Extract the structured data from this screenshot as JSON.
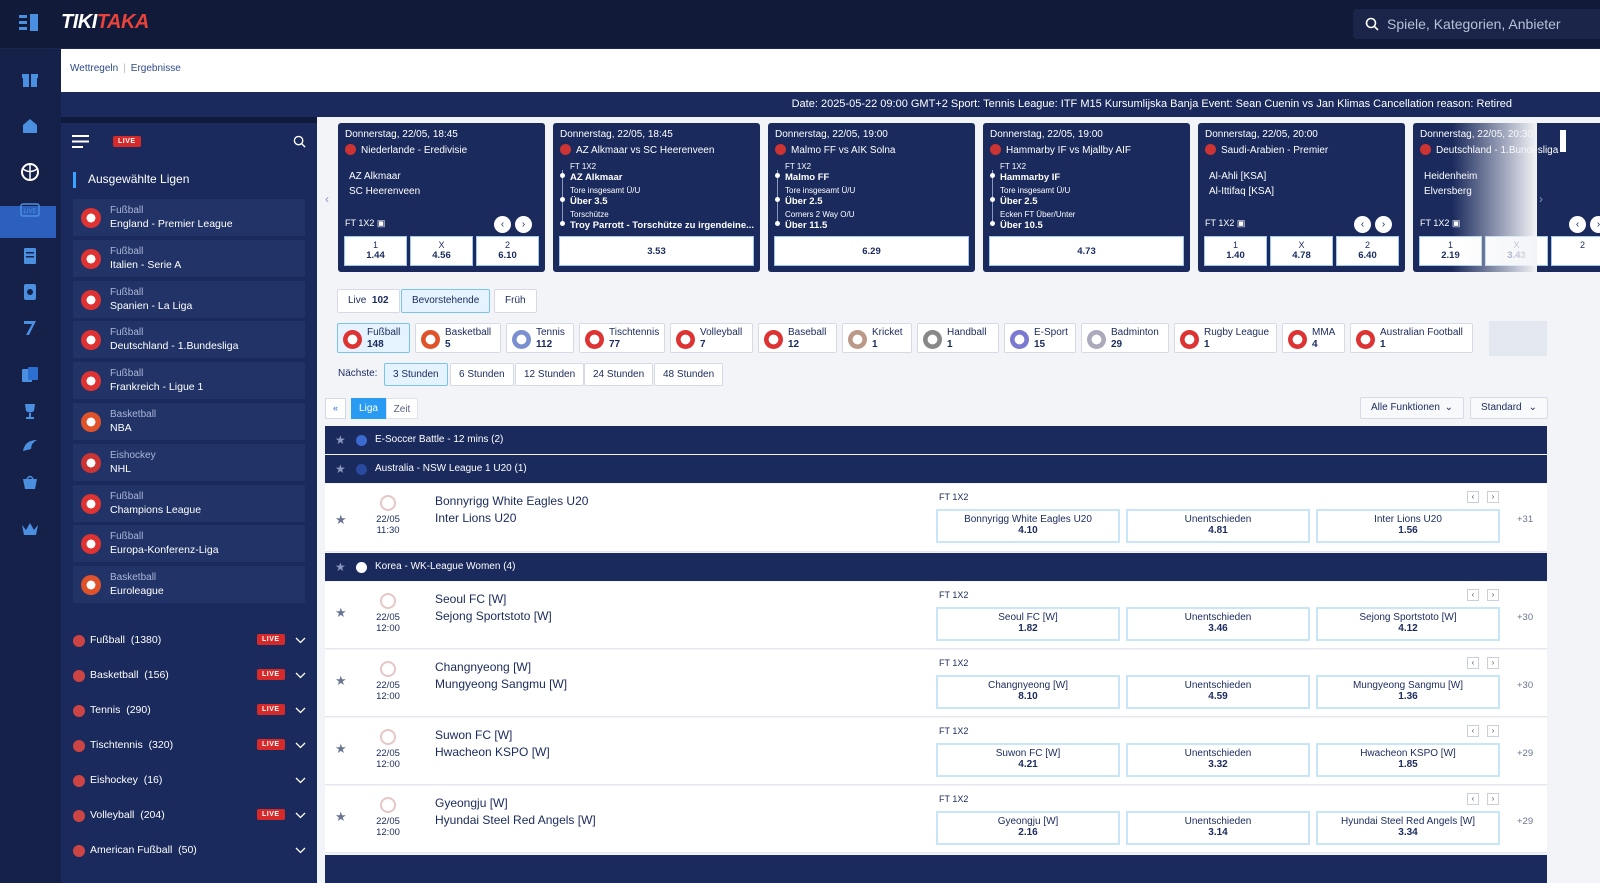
{
  "app": {
    "logo_a": "TIKI",
    "logo_b": "TAKA",
    "search_placeholder": "Spiele, Kategorien, Anbieter"
  },
  "breadcrumb": {
    "a": "Wettregeln",
    "b": "Ergebnisse"
  },
  "ticker": "Date: 2025-05-22 09:00 GMT+2 Sport: Tennis League: ITF M15 Kursumlijska Banja Event: Sean Cuenin vs Jan Klimas Cancellation reason: Retired",
  "sidebar": {
    "live": "LIVE",
    "title": "Ausgewählte Ligen",
    "leagues": [
      {
        "sport": "Fußball",
        "name": "England - Premier League"
      },
      {
        "sport": "Fußball",
        "name": "Italien - Serie A"
      },
      {
        "sport": "Fußball",
        "name": "Spanien - La Liga"
      },
      {
        "sport": "Fußball",
        "name": "Deutschland - 1.Bundesliga"
      },
      {
        "sport": "Fußball",
        "name": "Frankreich - Ligue 1"
      },
      {
        "sport": "Basketball",
        "name": "NBA"
      },
      {
        "sport": "Eishockey",
        "name": "NHL"
      },
      {
        "sport": "Fußball",
        "name": "Champions League"
      },
      {
        "sport": "Fußball",
        "name": "Europa-Konferenz-Liga"
      },
      {
        "sport": "Basketball",
        "name": "Euroleague"
      }
    ],
    "sports": [
      {
        "name": "Fußball",
        "count": "(1380)",
        "live": "LIVE"
      },
      {
        "name": "Basketball",
        "count": "(156)",
        "live": "LIVE"
      },
      {
        "name": "Tennis",
        "count": "(290)",
        "live": "LIVE"
      },
      {
        "name": "Tischtennis",
        "count": "(320)",
        "live": "LIVE"
      },
      {
        "name": "Eishockey",
        "count": "(16)",
        "live": ""
      },
      {
        "name": "Volleyball",
        "count": "(204)",
        "live": "LIVE"
      },
      {
        "name": "American Fußball",
        "count": "(50)",
        "live": ""
      }
    ]
  },
  "cards": [
    {
      "date": "Donnerstag, 22/05, 18:45",
      "league": "Niederlande - Eredivisie",
      "t1": "AZ Alkmaar",
      "t2": "SC Heerenveen",
      "market": "FT 1X2",
      "odds": [
        {
          "l": "1",
          "v": "1.44"
        },
        {
          "l": "X",
          "v": "4.56"
        },
        {
          "l": "2",
          "v": "6.10"
        }
      ]
    },
    {
      "date": "Donnerstag, 22/05, 18:45",
      "league": "AZ Alkmaar vs SC Heerenveen",
      "b1": "FT 1X2",
      "b1v": "AZ Alkmaar",
      "b2": "Tore insgesamt Ü/U",
      "b2v": "Über 3.5",
      "b3": "Torschütze",
      "b3v": "Troy Parrott - Torschütze zu irgendeine...",
      "total": "3.53"
    },
    {
      "date": "Donnerstag, 22/05, 19:00",
      "league": "Malmo FF vs AIK Solna",
      "b1": "FT 1X2",
      "b1v": "Malmo FF",
      "b2": "Tore insgesamt Ü/U",
      "b2v": "Über 2.5",
      "b3": "Corners 2 Way O/U",
      "b3v": "Über 11.5",
      "total": "6.29"
    },
    {
      "date": "Donnerstag, 22/05, 19:00",
      "league": "Hammarby IF vs Mjallby AIF",
      "b1": "FT 1X2",
      "b1v": "Hammarby IF",
      "b2": "Tore insgesamt Ü/U",
      "b2v": "Über 2.5",
      "b3": "Ecken FT Über/Unter",
      "b3v": "Über 10.5",
      "total": "4.73"
    },
    {
      "date": "Donnerstag, 22/05, 20:00",
      "league": "Saudi-Arabien - Premier",
      "t1": "Al-Ahli [KSA]",
      "t2": "Al-Ittifaq [KSA]",
      "market": "FT 1X2",
      "odds": [
        {
          "l": "1",
          "v": "1.40"
        },
        {
          "l": "X",
          "v": "4.78"
        },
        {
          "l": "2",
          "v": "6.40"
        }
      ]
    },
    {
      "date": "Donnerstag, 22/05, 20:30",
      "league": "Deutschland - 1.Bundesliga",
      "t1": "Heidenheim",
      "t2": "Elversberg",
      "market": "FT 1X2",
      "odds": [
        {
          "l": "1",
          "v": "2.19"
        },
        {
          "l": "X",
          "v": "3.43"
        },
        {
          "l": "2",
          "v": ""
        }
      ]
    }
  ],
  "tabs": [
    {
      "label": "Live",
      "count": "102"
    },
    {
      "label": "Bevorstehende",
      "count": ""
    },
    {
      "label": "Früh",
      "count": ""
    }
  ],
  "sports_chips": [
    {
      "name": "Fußball",
      "count": "148",
      "color": "#d33"
    },
    {
      "name": "Basketball",
      "count": "5",
      "color": "#e0522a"
    },
    {
      "name": "Tennis",
      "count": "112",
      "color": "#7a8fd0"
    },
    {
      "name": "Tischtennis",
      "count": "77",
      "color": "#d33"
    },
    {
      "name": "Volleyball",
      "count": "7",
      "color": "#d33"
    },
    {
      "name": "Baseball",
      "count": "12",
      "color": "#d33"
    },
    {
      "name": "Kricket",
      "count": "1",
      "color": "#b98"
    },
    {
      "name": "Handball",
      "count": "1",
      "color": "#888"
    },
    {
      "name": "E-Sport",
      "count": "15",
      "color": "#7a7ad0"
    },
    {
      "name": "Badminton",
      "count": "29",
      "color": "#aab"
    },
    {
      "name": "Rugby League",
      "count": "1",
      "color": "#d33"
    },
    {
      "name": "MMA",
      "count": "4",
      "color": "#d33"
    },
    {
      "name": "Australian Football",
      "count": "1",
      "color": "#d33"
    }
  ],
  "hours": {
    "label": "Nächste:",
    "options": [
      "3 Stunden",
      "6 Stunden",
      "12 Stunden",
      "24 Stunden",
      "48 Stunden"
    ]
  },
  "view": {
    "liga": "Liga",
    "zeit": "Zeit",
    "funcs": "Alle Funktionen",
    "sort": "Standard"
  },
  "sections": [
    {
      "name": "E-Soccer Battle - 12 mins (2)"
    },
    {
      "name": "Australia - NSW League 1 U20 (1)"
    },
    {
      "name": "Korea - WK-League Women (4)"
    }
  ],
  "events": [
    {
      "date": "22/05",
      "time": "11:30",
      "home": "Bonnyrigg White Eagles U20",
      "away": "Inter Lions U20",
      "market": "FT 1X2",
      "o1": "4.10",
      "ox": "4.81",
      "o2": "1.56",
      "draw": "Unentschieden",
      "more": "+31"
    },
    {
      "date": "22/05",
      "time": "12:00",
      "home": "Seoul FC [W]",
      "away": "Sejong Sportstoto [W]",
      "market": "FT 1X2",
      "o1": "1.82",
      "ox": "3.46",
      "o2": "4.12",
      "draw": "Unentschieden",
      "more": "+30"
    },
    {
      "date": "22/05",
      "time": "12:00",
      "home": "Changnyeong [W]",
      "away": "Mungyeong Sangmu [W]",
      "market": "FT 1X2",
      "o1": "8.10",
      "ox": "4.59",
      "o2": "1.36",
      "draw": "Unentschieden",
      "more": "+30"
    },
    {
      "date": "22/05",
      "time": "12:00",
      "home": "Suwon FC [W]",
      "away": "Hwacheon KSPO [W]",
      "market": "FT 1X2",
      "o1": "4.21",
      "ox": "3.32",
      "o2": "1.85",
      "draw": "Unentschieden",
      "more": "+29"
    },
    {
      "date": "22/05",
      "time": "12:00",
      "home": "Gyeongju [W]",
      "away": "Hyundai Steel Red Angels [W]",
      "market": "FT 1X2",
      "o1": "2.16",
      "ox": "3.14",
      "o2": "3.34",
      "draw": "Unentschieden",
      "more": "+29"
    }
  ]
}
